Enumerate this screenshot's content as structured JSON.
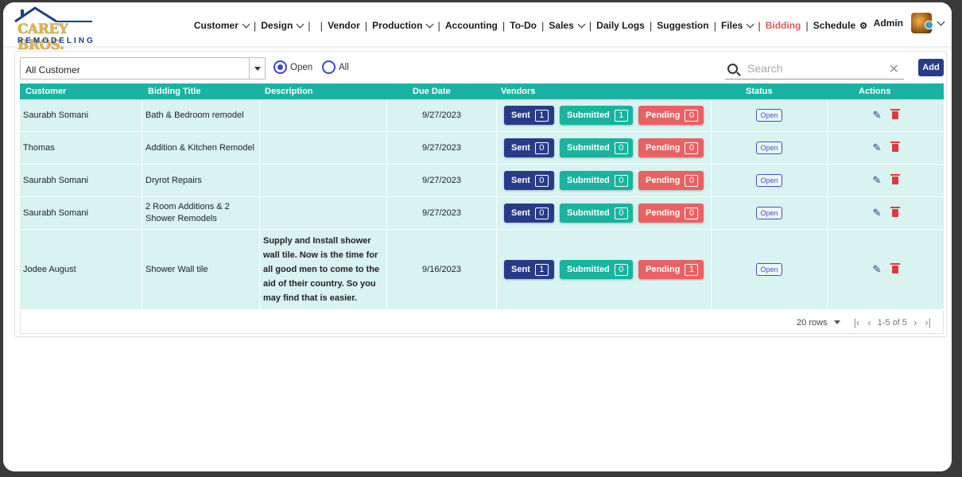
{
  "brand": {
    "logo_top": "CAREY BROS.",
    "logo_bottom": "REMODELING"
  },
  "nav": [
    {
      "label": "Customer",
      "dropdown": true
    },
    {
      "label": "Design",
      "dropdown": true
    },
    {
      "label": "",
      "dropdown": false
    },
    {
      "label": "Vendor",
      "dropdown": false
    },
    {
      "label": "Production",
      "dropdown": true
    },
    {
      "label": "Accounting",
      "dropdown": false
    },
    {
      "label": "To-Do",
      "dropdown": false
    },
    {
      "label": "Sales",
      "dropdown": true
    },
    {
      "label": "Daily Logs",
      "dropdown": false
    },
    {
      "label": "Suggestion",
      "dropdown": false
    },
    {
      "label": "Files",
      "dropdown": true
    },
    {
      "label": "Bidding",
      "dropdown": false,
      "active": true
    },
    {
      "label": "Schedule",
      "dropdown": false,
      "icon": "gear-icon"
    }
  ],
  "user": {
    "name": "Admin"
  },
  "colors": {
    "accent": "#1ab3a3",
    "primary": "#283b88",
    "danger": "#ea6163",
    "active_nav": "#e05a5a",
    "row_bg": "#d8f3f0"
  },
  "filters": {
    "customer_select": "All Customer",
    "radio_open": "Open",
    "radio_all": "All",
    "selected": "Open",
    "search_placeholder": "Search",
    "add_label": "Add"
  },
  "table": {
    "columns": [
      "Customer",
      "Bidding Title",
      "Description",
      "Due Date",
      "Vendors",
      "Status",
      "Actions"
    ],
    "vendor_labels": {
      "sent": "Sent",
      "submitted": "Submitted",
      "pending": "Pending"
    },
    "rows": [
      {
        "customer": "Saurabh Somani",
        "title": "Bath & Bedroom remodel",
        "description": "",
        "due": "9/27/2023",
        "sent": "1",
        "submitted": "1",
        "pending": "0",
        "status": "Open"
      },
      {
        "customer": "Thomas",
        "title": "Addition & Kitchen Remodel",
        "description": "",
        "due": "9/27/2023",
        "sent": "0",
        "submitted": "0",
        "pending": "0",
        "status": "Open"
      },
      {
        "customer": "Saurabh Somani",
        "title": "Dryrot Repairs",
        "description": "",
        "due": "9/27/2023",
        "sent": "0",
        "submitted": "0",
        "pending": "0",
        "status": "Open"
      },
      {
        "customer": "Saurabh Somani",
        "title": "2 Room Additions & 2 Shower Remodels",
        "description": "",
        "due": "9/27/2023",
        "sent": "0",
        "submitted": "0",
        "pending": "0",
        "status": "Open"
      },
      {
        "customer": "Jodee August",
        "title": "Shower Wall tile",
        "description": "Supply and Install shower wall tile. Now is the time for all good men to come to the aid of their country. So you may find that is easier.",
        "due": "9/16/2023",
        "sent": "1",
        "submitted": "0",
        "pending": "1",
        "status": "Open"
      }
    ]
  },
  "pagination": {
    "rows_per_page": "20 rows",
    "range": "1-5 of 5"
  }
}
